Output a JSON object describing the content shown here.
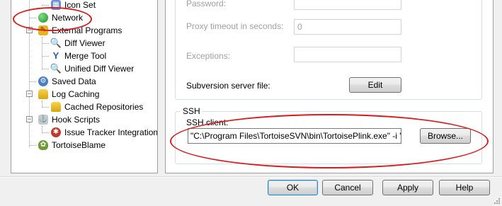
{
  "tree": {
    "items": [
      {
        "label": "Icon Set",
        "icon": "icon-set-icon"
      },
      {
        "label": "Network",
        "icon": "network-globe-icon",
        "selected": true
      },
      {
        "label": "External Programs",
        "icon": "external-programs-icon"
      },
      {
        "label": "Diff Viewer",
        "icon": "diff-viewer-icon"
      },
      {
        "label": "Merge Tool",
        "icon": "merge-tool-icon"
      },
      {
        "label": "Unified Diff Viewer",
        "icon": "unified-diff-icon"
      },
      {
        "label": "Saved Data",
        "icon": "saved-data-icon"
      },
      {
        "label": "Log Caching",
        "icon": "log-caching-icon"
      },
      {
        "label": "Cached Repositories",
        "icon": "cached-repositories-icon"
      },
      {
        "label": "Hook Scripts",
        "icon": "hook-scripts-icon"
      },
      {
        "label": "Issue Tracker Integration",
        "icon": "bug-icon"
      },
      {
        "label": "TortoiseBlame",
        "icon": "tortoiseblame-icon"
      }
    ]
  },
  "proxy": {
    "password_label": "Password:",
    "password_value": "",
    "timeout_label": "Proxy timeout in seconds:",
    "timeout_value": "0",
    "exceptions_label": "Exceptions:",
    "exceptions_value": "",
    "server_file_label": "Subversion server file:",
    "edit_button": "Edit"
  },
  "ssh": {
    "group_title": "SSH",
    "client_label": "SSH client:",
    "client_value": "\"C:\\Program Files\\TortoiseSVN\\bin\\TortoisePlink.exe\" -i \"C:\\Us",
    "browse_button": "Browse..."
  },
  "footer": {
    "ok": "OK",
    "cancel": "Cancel",
    "apply": "Apply",
    "help": "Help"
  },
  "colors": {
    "highlight_oval": "#d81d1d",
    "default_button_border": "#3c7fb1"
  }
}
